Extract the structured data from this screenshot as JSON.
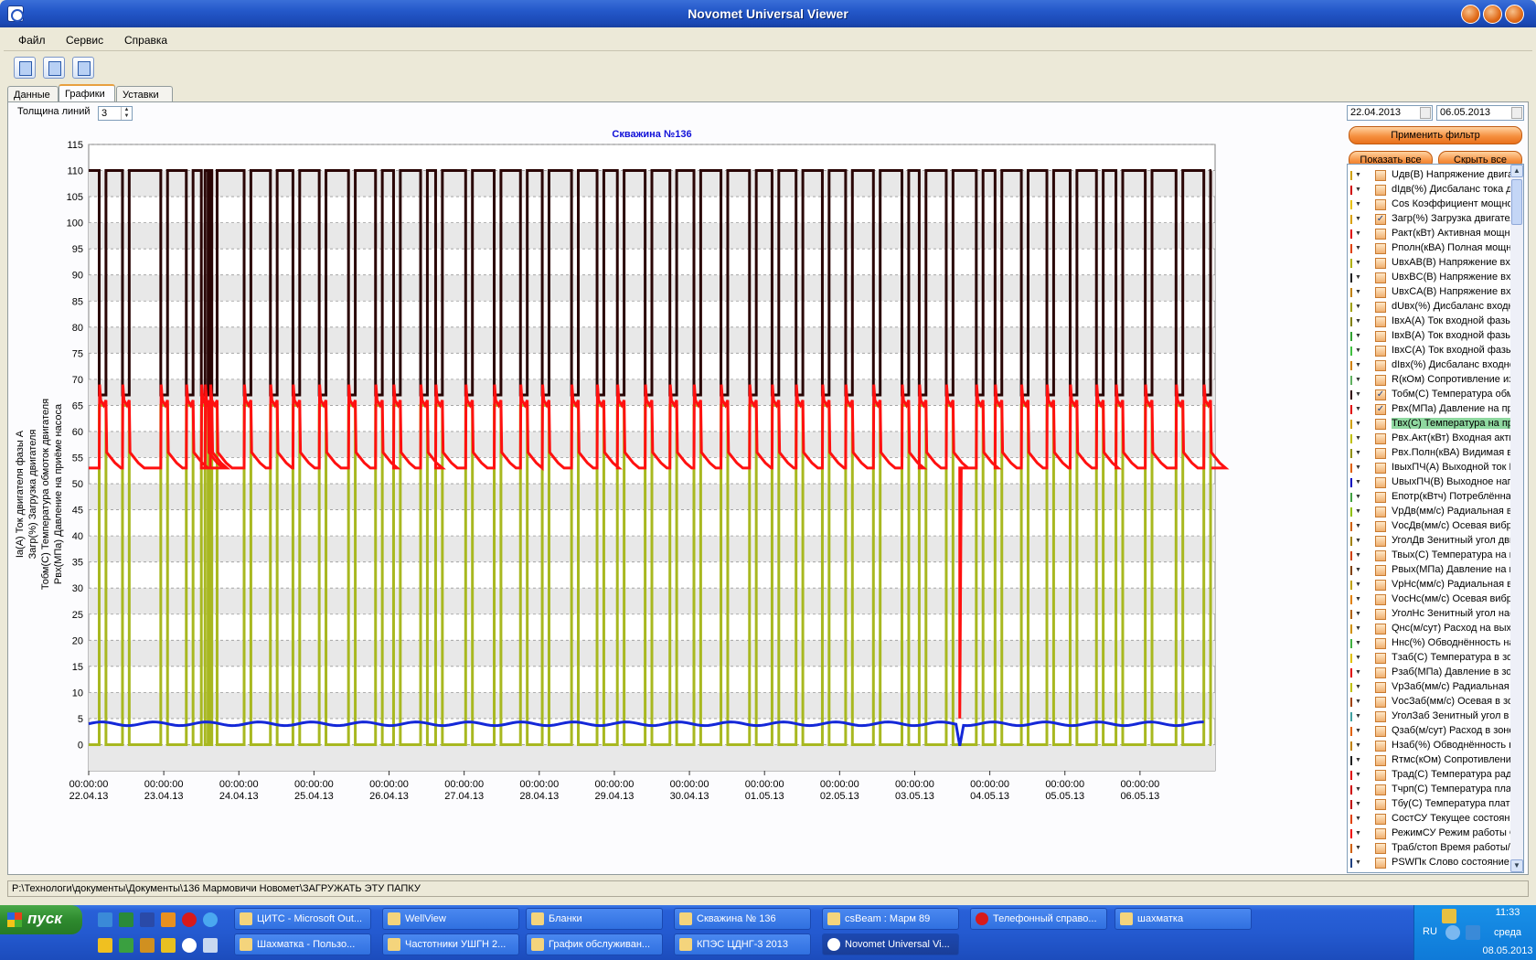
{
  "window": {
    "title": "Novomet Universal Viewer"
  },
  "menu": [
    "Файл",
    "Сервис",
    "Справка"
  ],
  "tabs": [
    "Данные",
    "Графики",
    "Уставки"
  ],
  "controls": {
    "thickness_label": "Толщина линий",
    "thickness_value": "3"
  },
  "filter": {
    "date_from": "22.04.2013",
    "date_to": "06.05.2013",
    "apply": "Применить фильтр",
    "show_all": "Показать все",
    "hide_all": "Скрыть все"
  },
  "params": [
    {
      "label": "Uдв(В) Напряжение двигателя",
      "color": "#d0a000",
      "checked": false
    },
    {
      "label": "dIдв(%) Дисбаланс тока двигателя",
      "color": "#d00000",
      "checked": false
    },
    {
      "label": "Cos Коэффициент мощности",
      "color": "#e8c000",
      "checked": false
    },
    {
      "label": "Загр(%) Загрузка двигателя",
      "color": "#d8a000",
      "checked": true
    },
    {
      "label": "Ракт(кВт) Активная мощность",
      "color": "#e00000",
      "checked": false
    },
    {
      "label": "Рполн(кВА) Полная мощность",
      "color": "#e04000",
      "checked": false
    },
    {
      "label": "UвхAB(В) Напряжение входное",
      "color": "#b0b000",
      "checked": false
    },
    {
      "label": "UвхBC(В) Напряжение входное",
      "color": "#202020",
      "checked": false
    },
    {
      "label": "UвхCA(В) Напряжение входное",
      "color": "#c08000",
      "checked": false
    },
    {
      "label": "dUвх(%) Дисбаланс входного",
      "color": "#a0a000",
      "checked": false
    },
    {
      "label": "IвхA(А) Ток входной фазы А",
      "color": "#808000",
      "checked": false
    },
    {
      "label": "IвхB(А) Ток входной фазы B",
      "color": "#30a030",
      "checked": false
    },
    {
      "label": "IвхC(А) Ток входной фазы C",
      "color": "#40c040",
      "checked": false
    },
    {
      "label": "dIвх(%) Дисбаланс входного",
      "color": "#d08000",
      "checked": false
    },
    {
      "label": "R(кОм) Сопротивление изоляции",
      "color": "#60b060",
      "checked": false
    },
    {
      "label": "Тобм(С) Температура обмоток",
      "color": "#300000",
      "checked": true
    },
    {
      "label": "Рвх(МПа) Давление на приеме",
      "color": "#e00000",
      "checked": true
    },
    {
      "label": "Твх(С) Температура на приеме",
      "color": "#d0a000",
      "checked": false,
      "highlight": true
    },
    {
      "label": "Рвх.Акт(кВт) Входная активная",
      "color": "#c0c000",
      "checked": false
    },
    {
      "label": "Рвх.Полн(кВА) Видимая входная",
      "color": "#909000",
      "checked": false
    },
    {
      "label": "IвыхПЧ(А) Выходной ток ПЧ",
      "color": "#e06000",
      "checked": false
    },
    {
      "label": "UвыхПЧ(В) Выходное напряжение",
      "color": "#0000c0",
      "checked": false
    },
    {
      "label": "Епотр(кВтч) Потреблённая",
      "color": "#40a040",
      "checked": false
    },
    {
      "label": "VрДв(мм/с) Радиальная вибрация",
      "color": "#90c000",
      "checked": false
    },
    {
      "label": "VосДв(мм/с) Осевая вибрация",
      "color": "#d06000",
      "checked": false
    },
    {
      "label": "УголДв Зенитный угол двигателя",
      "color": "#a08000",
      "checked": false
    },
    {
      "label": "Твых(С) Температура на выходе",
      "color": "#d04000",
      "checked": false
    },
    {
      "label": "Рвых(МПа) Давление на выходе",
      "color": "#804000",
      "checked": false
    },
    {
      "label": "VрНс(мм/с) Радиальная вибрация",
      "color": "#c0a000",
      "checked": false
    },
    {
      "label": "VосНс(мм/с) Осевая вибрация",
      "color": "#e08000",
      "checked": false
    },
    {
      "label": "УголНс Зенитный угол насоса",
      "color": "#b06000",
      "checked": false
    },
    {
      "label": "Qнс(м/сут) Расход на выходе",
      "color": "#d09000",
      "checked": false
    },
    {
      "label": "Ннс(%) Обводнённость на выходе",
      "color": "#40b040",
      "checked": false
    },
    {
      "label": "Тзаб(С) Температура в зоне",
      "color": "#e0c000",
      "checked": false
    },
    {
      "label": "Рзаб(МПа) Давление в зоне",
      "color": "#e00000",
      "checked": false
    },
    {
      "label": "VрЗаб(мм/с) Радиальная",
      "color": "#c0c000",
      "checked": false
    },
    {
      "label": "VосЗаб(мм/с) Осевая в зоне",
      "color": "#a04000",
      "checked": false
    },
    {
      "label": "УголЗаб Зенитный угол в зоне",
      "color": "#40a0a0",
      "checked": false
    },
    {
      "label": "Qзаб(м/сут) Расход в зоне",
      "color": "#e06000",
      "checked": false
    },
    {
      "label": "Нзаб(%) Обводнённость в зоне",
      "color": "#c08000",
      "checked": false
    },
    {
      "label": "Rтмс(кОм) Сопротивление ТМС",
      "color": "#202020",
      "checked": false
    },
    {
      "label": "Трад(С) Температура радиатора",
      "color": "#e00000",
      "checked": false
    },
    {
      "label": "Тчрп(С) Температура платы",
      "color": "#d00000",
      "checked": false
    },
    {
      "label": "Тбу(С) Температура платы БУ",
      "color": "#c00000",
      "checked": false
    },
    {
      "label": "СостСУ Текущее состояние",
      "color": "#e04000",
      "checked": false
    },
    {
      "label": "РежимСУ Режим работы СУ",
      "color": "#f00000",
      "checked": false
    },
    {
      "label": "Траб/стоп Время работы/стоп",
      "color": "#d06000",
      "checked": false
    },
    {
      "label": "PSWПк Слово состояние ПК",
      "color": "#204080",
      "checked": false
    }
  ],
  "status": {
    "path": "P:\\Технологи\\документы\\Документы\\136 Мармовичи Новомет\\ЗАГРУЖАТЬ ЭТУ ПАПКУ"
  },
  "taskbar": {
    "start": "пуск",
    "row1": [
      "ЦИТС - Microsoft Out...",
      "WellView",
      "Бланки",
      "Скважина № 136",
      "csBeam : Марм 89",
      "Телефонный справо...",
      "шахматка"
    ],
    "row2": [
      "Шахматка - Пользо...",
      "Частотники УШГН 2...",
      "График обслуживан...",
      "КПЭС ЦДНГ-3 2013",
      "Novomet Universal Vi..."
    ],
    "lang": "RU",
    "time": "11:33",
    "day": "среда",
    "date": "08.05.2013"
  },
  "chart_data": {
    "type": "line",
    "title": "Скважина №136",
    "ylabel": [
      "Iа(А) Ток двигателя фазы А",
      "Загр(%) Загрузка двигателя",
      "Тобм(С) Температура обмоток двигателя",
      "Рвх(МПа) Давление на приёме насоса"
    ],
    "ylim": [
      -5,
      115
    ],
    "yticks": [
      0,
      5,
      10,
      15,
      20,
      25,
      30,
      35,
      40,
      45,
      50,
      55,
      60,
      65,
      70,
      75,
      80,
      85,
      90,
      95,
      100,
      105,
      110,
      115
    ],
    "xlim": [
      0,
      15
    ],
    "xticks": [
      0,
      1,
      2,
      3,
      4,
      5,
      6,
      7,
      8,
      9,
      10,
      11,
      12,
      13,
      14
    ],
    "xtick_labels": [
      [
        "00:00:00",
        "22.04.13"
      ],
      [
        "00:00:00",
        "23.04.13"
      ],
      [
        "00:00:00",
        "24.04.13"
      ],
      [
        "00:00:00",
        "25.04.13"
      ],
      [
        "00:00:00",
        "26.04.13"
      ],
      [
        "00:00:00",
        "27.04.13"
      ],
      [
        "00:00:00",
        "28.04.13"
      ],
      [
        "00:00:00",
        "29.04.13"
      ],
      [
        "00:00:00",
        "30.04.13"
      ],
      [
        "00:00:00",
        "01.05.13"
      ],
      [
        "00:00:00",
        "02.05.13"
      ],
      [
        "00:00:00",
        "03.05.13"
      ],
      [
        "00:00:00",
        "04.05.13"
      ],
      [
        "00:00:00",
        "05.05.13"
      ],
      [
        "00:00:00",
        "06.05.13"
      ]
    ],
    "grid": true,
    "run_starts": [
      0.14,
      0.45,
      0.96,
      1.3,
      1.5,
      1.55,
      1.62,
      2.07,
      2.42,
      2.72,
      3.07,
      3.46,
      3.82,
      4.06,
      4.42,
      4.62,
      5.02,
      5.4,
      5.75,
      6.04,
      6.43,
      6.77,
      7.04,
      7.41,
      7.74,
      8.06,
      8.42,
      8.8,
      9.1,
      9.42,
      9.77,
      10.08,
      10.45,
      10.83,
      11.06,
      11.42,
      11.82,
      12.07,
      12.42,
      12.76,
      13.07,
      13.42,
      13.68,
      14.07,
      14.48,
      14.85
    ],
    "run_duration": 0.09,
    "series": [
      {
        "name": "Тобм(С)",
        "color": "#2a0505",
        "stop_value": 110,
        "run_value": 67
      },
      {
        "name": "Рвх(МПа)",
        "color": "#ff1010",
        "base_value": 53,
        "peak_value": 67,
        "anomaly": {
          "x": 11.6,
          "value": 5
        }
      },
      {
        "name": "Загр(%)",
        "color": "#a8b820",
        "stop_value": 0,
        "run_value": 65
      },
      {
        "name": "Iа(А)",
        "color": "#1428d8",
        "base_value": 4
      }
    ]
  }
}
